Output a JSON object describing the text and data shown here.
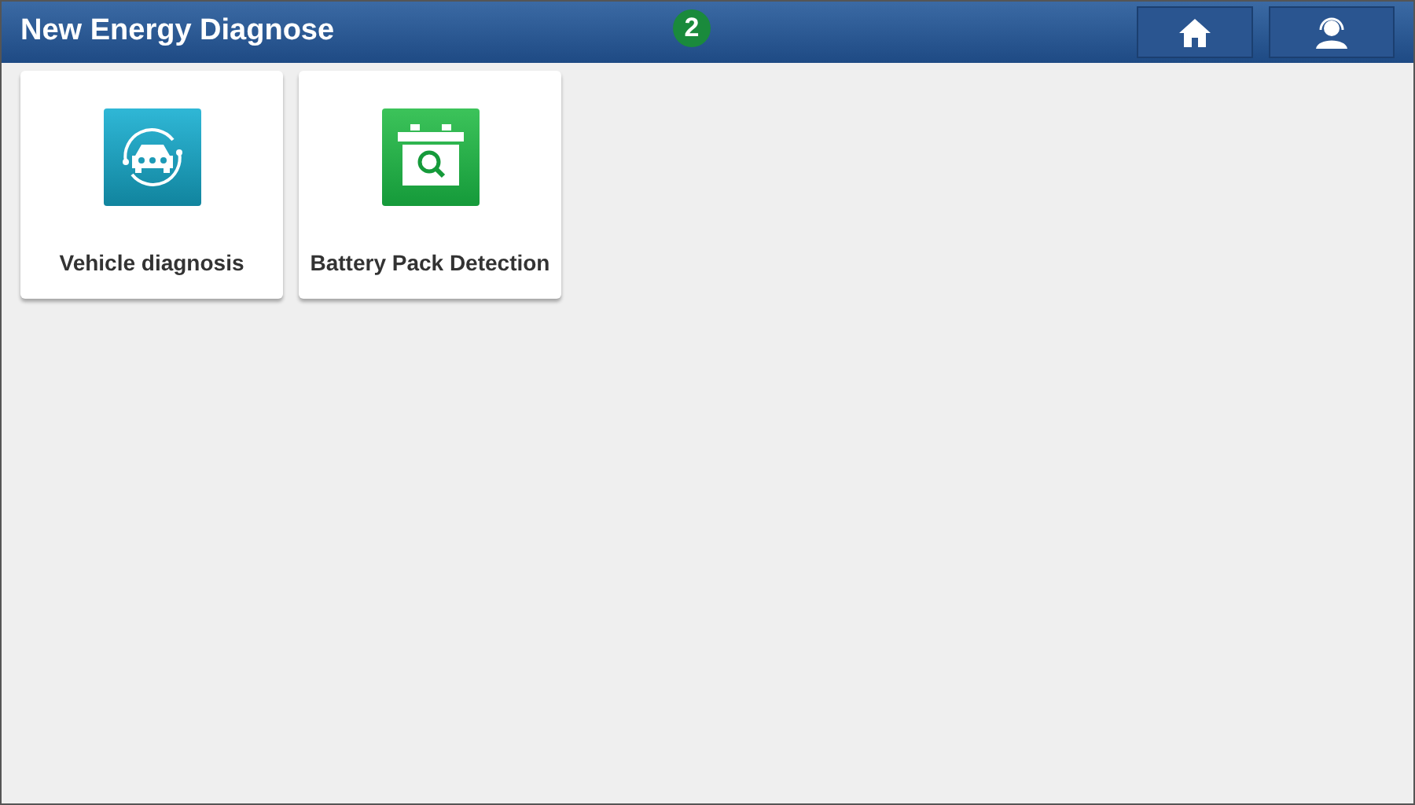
{
  "header": {
    "title": "New Energy Diagnose",
    "callout": "2"
  },
  "tiles": [
    {
      "kind": "vehicle",
      "label": "Vehicle diagnosis"
    },
    {
      "kind": "battery",
      "label": "Battery Pack Detection"
    }
  ]
}
